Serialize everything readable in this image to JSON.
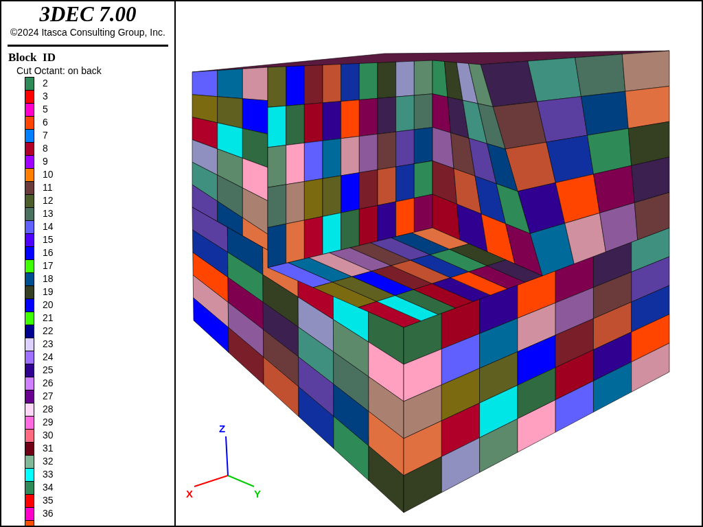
{
  "header": {
    "title": "3DEC 7.00",
    "copyright": "©2024 Itasca Consulting Group, Inc."
  },
  "legend": {
    "title": "Block  ID",
    "subtitle": "Cut Octant: on back",
    "items": [
      {
        "label": "2",
        "color": "#2e8b57"
      },
      {
        "label": "3",
        "color": "#ff0000"
      },
      {
        "label": "5",
        "color": "#ff00cc"
      },
      {
        "label": "6",
        "color": "#ff4500"
      },
      {
        "label": "7",
        "color": "#0080ff"
      },
      {
        "label": "8",
        "color": "#b0002a"
      },
      {
        "label": "9",
        "color": "#a000ff"
      },
      {
        "label": "10",
        "color": "#ff8000"
      },
      {
        "label": "11",
        "color": "#6b3a3a"
      },
      {
        "label": "12",
        "color": "#4b5e2a"
      },
      {
        "label": "13",
        "color": "#4a7060"
      },
      {
        "label": "14",
        "color": "#6060ff"
      },
      {
        "label": "15",
        "color": "#5000ff"
      },
      {
        "label": "16",
        "color": "#0000ff"
      },
      {
        "label": "17",
        "color": "#40ff00"
      },
      {
        "label": "18",
        "color": "#004f90"
      },
      {
        "label": "19",
        "color": "#353f22"
      },
      {
        "label": "20",
        "color": "#0000fe"
      },
      {
        "label": "21",
        "color": "#40ff01"
      },
      {
        "label": "22",
        "color": "#000090"
      },
      {
        "label": "23",
        "color": "#ddd0ff"
      },
      {
        "label": "24",
        "color": "#9f6fff"
      },
      {
        "label": "25",
        "color": "#300090"
      },
      {
        "label": "26",
        "color": "#d080ff"
      },
      {
        "label": "27",
        "color": "#6a0090"
      },
      {
        "label": "28",
        "color": "#ffd8f8"
      },
      {
        "label": "29",
        "color": "#ff6adf"
      },
      {
        "label": "30",
        "color": "#ff6a80"
      },
      {
        "label": "31",
        "color": "#700015"
      },
      {
        "label": "32",
        "color": "#80b898"
      },
      {
        "label": "33",
        "color": "#00ffff"
      },
      {
        "label": "34",
        "color": "#2e8b58"
      },
      {
        "label": "35",
        "color": "#ff0001"
      },
      {
        "label": "36",
        "color": "#ff00cb"
      },
      {
        "color": "#ff5000"
      }
    ]
  },
  "axes": {
    "x": "X",
    "y": "Y",
    "z": "Z"
  }
}
